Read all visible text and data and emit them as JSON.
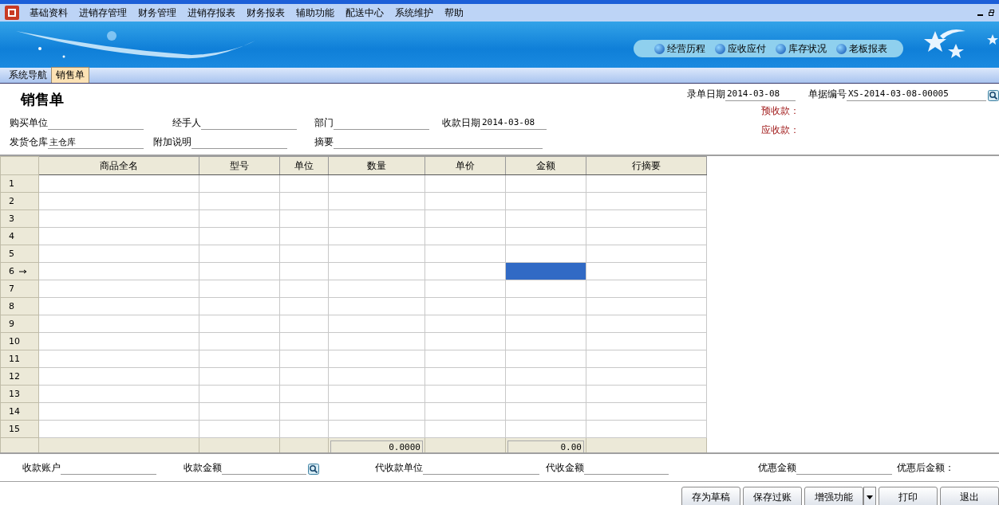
{
  "menu": [
    "基础资料",
    "进销存管理",
    "财务管理",
    "进销存报表",
    "财务报表",
    "辅助功能",
    "配送中心",
    "系统维护",
    "帮助"
  ],
  "quick_links": [
    "经营历程",
    "应收应付",
    "库存状况",
    "老板报表"
  ],
  "tabs": [
    {
      "label": "系统导航",
      "selected": false
    },
    {
      "label": "销售单",
      "selected": true
    }
  ],
  "form": {
    "title": "销售单",
    "top_right": [
      {
        "label": "录单日期",
        "value": "2014-03-08",
        "kind": "date"
      },
      {
        "label": "单据编号",
        "value": "XS-2014-03-08-00005",
        "kind": "lookup"
      }
    ],
    "row1": [
      {
        "label": "购买单位"
      },
      {
        "label": "经手人"
      },
      {
        "label": "部门"
      },
      {
        "label": "收款日期",
        "value": "2014-03-08"
      }
    ],
    "row2": [
      {
        "label": "发货仓库",
        "value": "主仓库"
      },
      {
        "label": "附加说明"
      },
      {
        "label": "摘要"
      }
    ],
    "notes": [
      "预收款：",
      "应收款："
    ]
  },
  "table": {
    "columns": [
      {
        "label": "商品全名",
        "kind": "name"
      },
      {
        "label": "型号",
        "kind": "model"
      },
      {
        "label": "单位",
        "kind": "unit"
      },
      {
        "label": "数量",
        "kind": "quantity",
        "total": "0.0000"
      },
      {
        "label": "单价",
        "kind": "price"
      },
      {
        "label": "金额",
        "kind": "amount",
        "total": "0.00"
      },
      {
        "label": "行摘要",
        "kind": "note"
      }
    ],
    "rows": [
      {
        "number": "1",
        "current": false
      },
      {
        "number": "2",
        "current": false
      },
      {
        "number": "3",
        "current": false
      },
      {
        "number": "4",
        "current": false
      },
      {
        "number": "5",
        "current": false
      },
      {
        "number": "6",
        "current": true
      },
      {
        "number": "7",
        "current": false
      },
      {
        "number": "8",
        "current": false
      },
      {
        "number": "9",
        "current": false
      },
      {
        "number": "10",
        "current": false
      },
      {
        "number": "11",
        "current": false
      },
      {
        "number": "12",
        "current": false
      },
      {
        "number": "13",
        "current": false
      },
      {
        "number": "14",
        "current": false
      },
      {
        "number": "15",
        "current": false
      }
    ]
  },
  "payment": [
    {
      "label": "收款账户",
      "kind": "field"
    },
    {
      "label": "收款金额",
      "kind": "lookup"
    },
    {
      "label": "代收款单位",
      "kind": "field"
    },
    {
      "label": "代收金额",
      "kind": "field"
    },
    {
      "label": "优惠金额",
      "kind": "gapfield"
    },
    {
      "label": "优惠后金额：",
      "kind": "text"
    }
  ],
  "buttons": [
    {
      "label": "存为草稿",
      "kind": "plain"
    },
    {
      "label": "保存过账",
      "kind": "plain"
    },
    {
      "label": "增强功能",
      "kind": "dropdown"
    },
    {
      "label": "打印",
      "kind": "plain"
    },
    {
      "label": "退出",
      "kind": "plain"
    }
  ]
}
